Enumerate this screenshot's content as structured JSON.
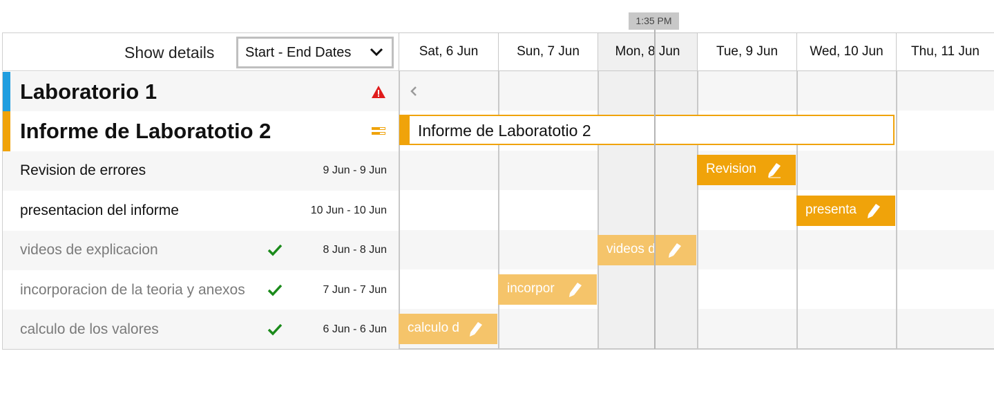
{
  "timeline": {
    "current_time": "1:35 PM",
    "days": [
      {
        "label": "Sat, 6 Jun",
        "today": false
      },
      {
        "label": "Sun, 7 Jun",
        "today": false
      },
      {
        "label": "Mon, 8 Jun",
        "today": true
      },
      {
        "label": "Tue, 9 Jun",
        "today": false
      },
      {
        "label": "Wed, 10 Jun",
        "today": false
      },
      {
        "label": "Thu, 11 Jun",
        "today": false
      }
    ]
  },
  "header": {
    "show_details_label": "Show details",
    "details_select_value": "Start - End Dates"
  },
  "colors": {
    "accent": "#f0a30a",
    "group_blue": "#1f9ee0",
    "done_green": "#1a8a1a",
    "warning_red": "#e01b1b"
  },
  "rows": [
    {
      "type": "group",
      "name": "Laboratorio 1",
      "stripe": "#1f9ee0",
      "icon": "warning-icon"
    },
    {
      "type": "group",
      "name": "Informe de Laboratotio 2",
      "stripe": "#f0a30a",
      "icon": "summary-bars-icon",
      "bar_label": "Informe de Laboratotio 2"
    },
    {
      "type": "task",
      "name": "Revision de errores",
      "dates": "9 Jun - 9 Jun",
      "done": false,
      "bar_label": "Revision",
      "day_index": 3
    },
    {
      "type": "task",
      "name": "presentacion del informe",
      "dates": "10 Jun - 10 Jun",
      "done": false,
      "bar_label": "presenta",
      "day_index": 4
    },
    {
      "type": "task",
      "name": "videos de explicacion",
      "dates": "8 Jun - 8 Jun",
      "done": true,
      "bar_label": "videos d",
      "day_index": 2
    },
    {
      "type": "task",
      "name": "incorporacion de la teoria y anexos",
      "dates": "7 Jun - 7 Jun",
      "done": true,
      "bar_label": "incorpor",
      "day_index": 1
    },
    {
      "type": "task",
      "name": "calculo de los valores",
      "dates": "6 Jun - 6 Jun",
      "done": true,
      "bar_label": "calculo d",
      "day_index": 0
    }
  ]
}
